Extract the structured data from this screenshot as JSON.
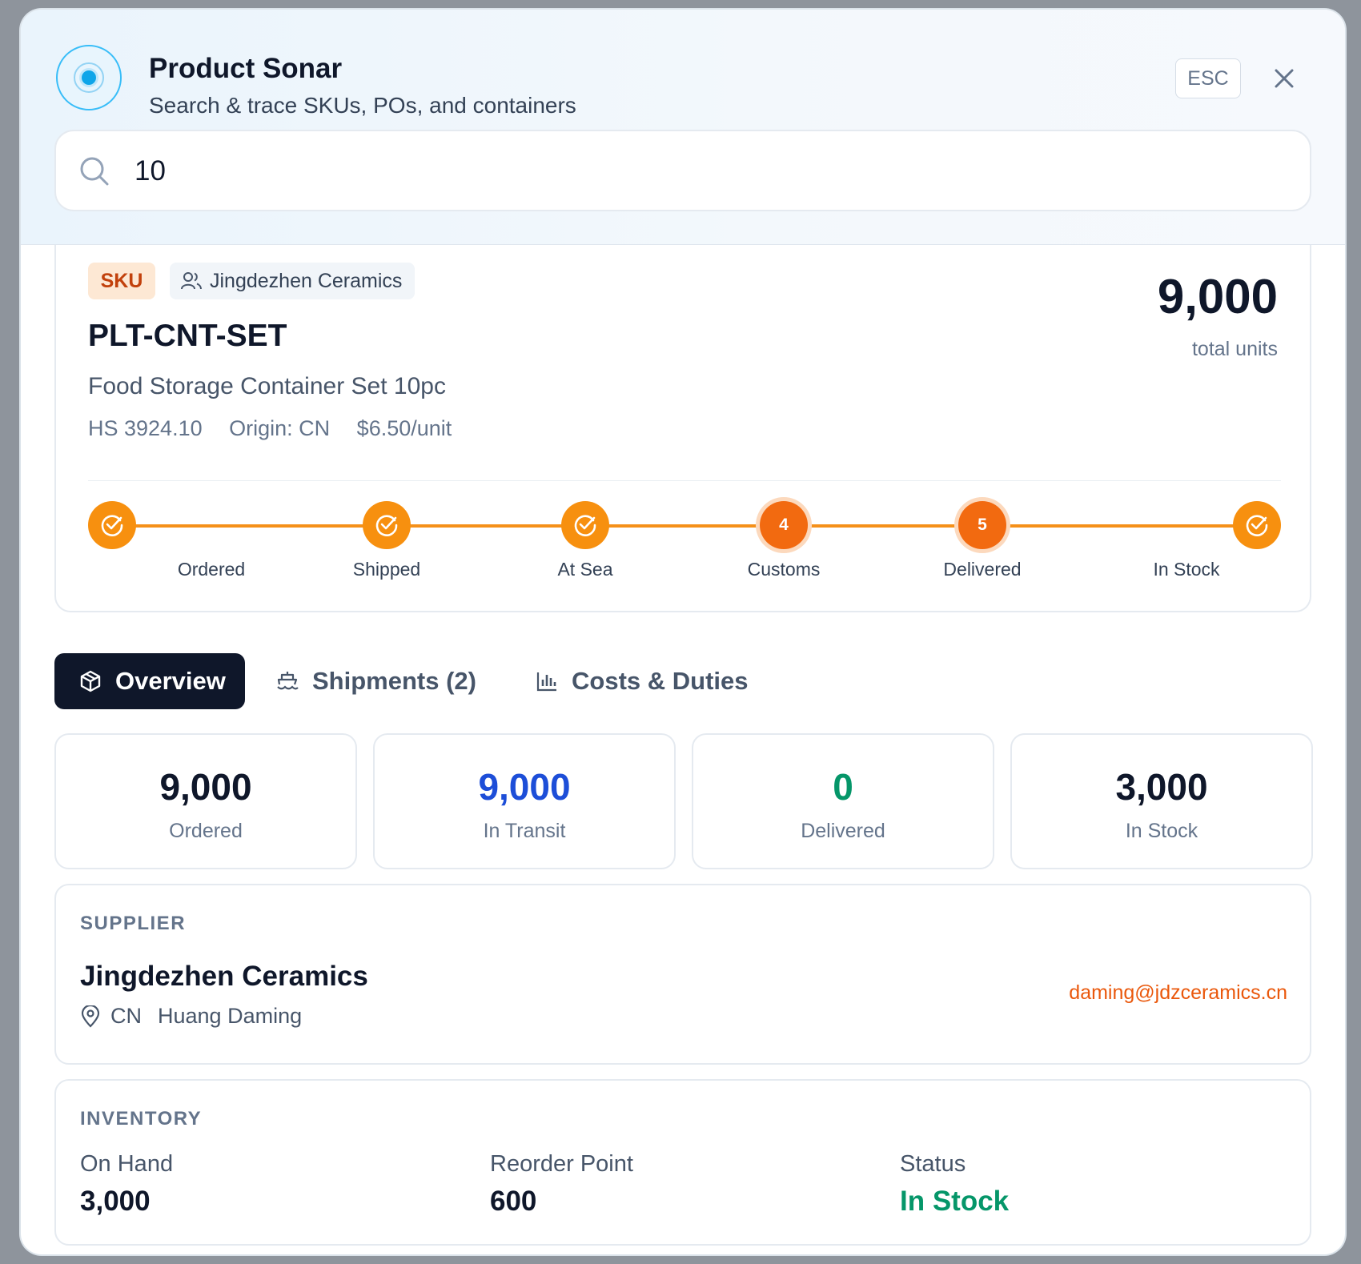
{
  "header": {
    "title": "Product Sonar",
    "subtitle": "Search & trace SKUs, POs, and containers",
    "esc_label": "ESC"
  },
  "search": {
    "value": "10"
  },
  "product": {
    "type_badge": "SKU",
    "supplier_badge": "Jingdezhen Ceramics",
    "sku": "PLT-CNT-SET",
    "name": "Food Storage Container Set 10pc",
    "hs_code": "HS 3924.10",
    "origin": "Origin: CN",
    "unit_price": "$6.50/unit",
    "total_units": "9,000",
    "total_units_label": "total units"
  },
  "timeline": {
    "steps": [
      {
        "label": "Ordered",
        "state": "done"
      },
      {
        "label": "Shipped",
        "state": "done"
      },
      {
        "label": "At Sea",
        "state": "done"
      },
      {
        "label": "Customs",
        "state": "pending",
        "number": "4"
      },
      {
        "label": "Delivered",
        "state": "pending",
        "number": "5"
      },
      {
        "label": "In Stock",
        "state": "done"
      }
    ]
  },
  "tabs": [
    {
      "label": "Overview",
      "icon": "box-icon",
      "active": true
    },
    {
      "label": "Shipments (2)",
      "icon": "ship-icon",
      "active": false
    },
    {
      "label": "Costs & Duties",
      "icon": "bar-chart-icon",
      "active": false
    }
  ],
  "stats": [
    {
      "value": "9,000",
      "label": "Ordered",
      "color": "#0f172a"
    },
    {
      "value": "9,000",
      "label": "In Transit",
      "color": "#1d4ed8"
    },
    {
      "value": "0",
      "label": "Delivered",
      "color": "#059669"
    },
    {
      "value": "3,000",
      "label": "In Stock",
      "color": "#0f172a"
    }
  ],
  "supplier": {
    "section_title": "SUPPLIER",
    "name": "Jingdezhen Ceramics",
    "country": "CN",
    "contact": "Huang Daming",
    "email": "daming@jdzceramics.cn"
  },
  "inventory": {
    "section_title": "INVENTORY",
    "on_hand_label": "On Hand",
    "on_hand": "3,000",
    "reorder_label": "Reorder Point",
    "reorder": "600",
    "status_label": "Status",
    "status": "In Stock",
    "status_color": "#059669"
  },
  "colors": {
    "accent": "#f7900f",
    "accent_dark": "#f26a10",
    "nav_active": "#0f172a"
  }
}
